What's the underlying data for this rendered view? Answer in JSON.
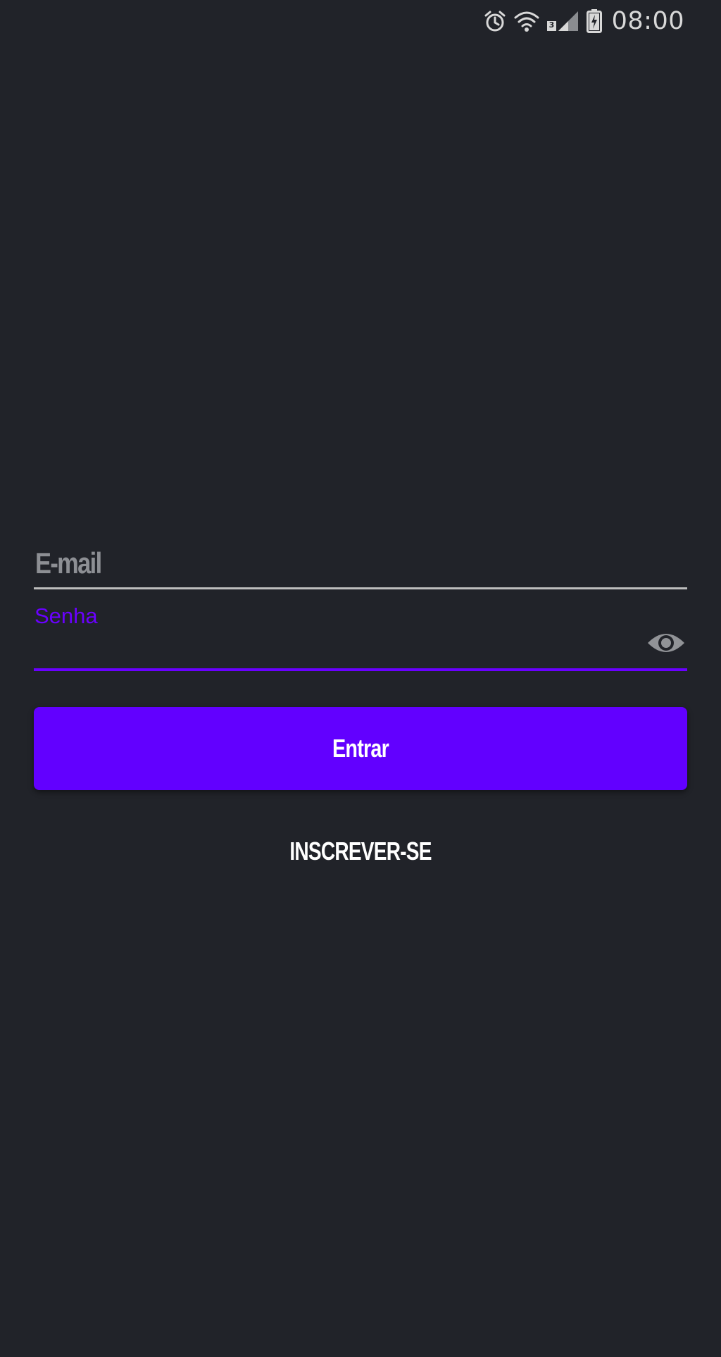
{
  "status_bar": {
    "time": "08:00",
    "icons": [
      "alarm-icon",
      "wifi-icon",
      "signal-icon",
      "battery-charging-icon"
    ],
    "sim_label": "3"
  },
  "login_form": {
    "email_placeholder": "E-mail",
    "email_value": "",
    "password_label": "Senha",
    "password_value": "",
    "password_toggle_icon": "eye-icon",
    "login_button_label": "Entrar",
    "signup_link_label": "INSCREVER-SE"
  },
  "colors": {
    "background": "#212329",
    "accent": "#6200ff",
    "focus_label": "#6a00ff",
    "placeholder": "#8d8f94",
    "underline": "#bdbdbd"
  }
}
